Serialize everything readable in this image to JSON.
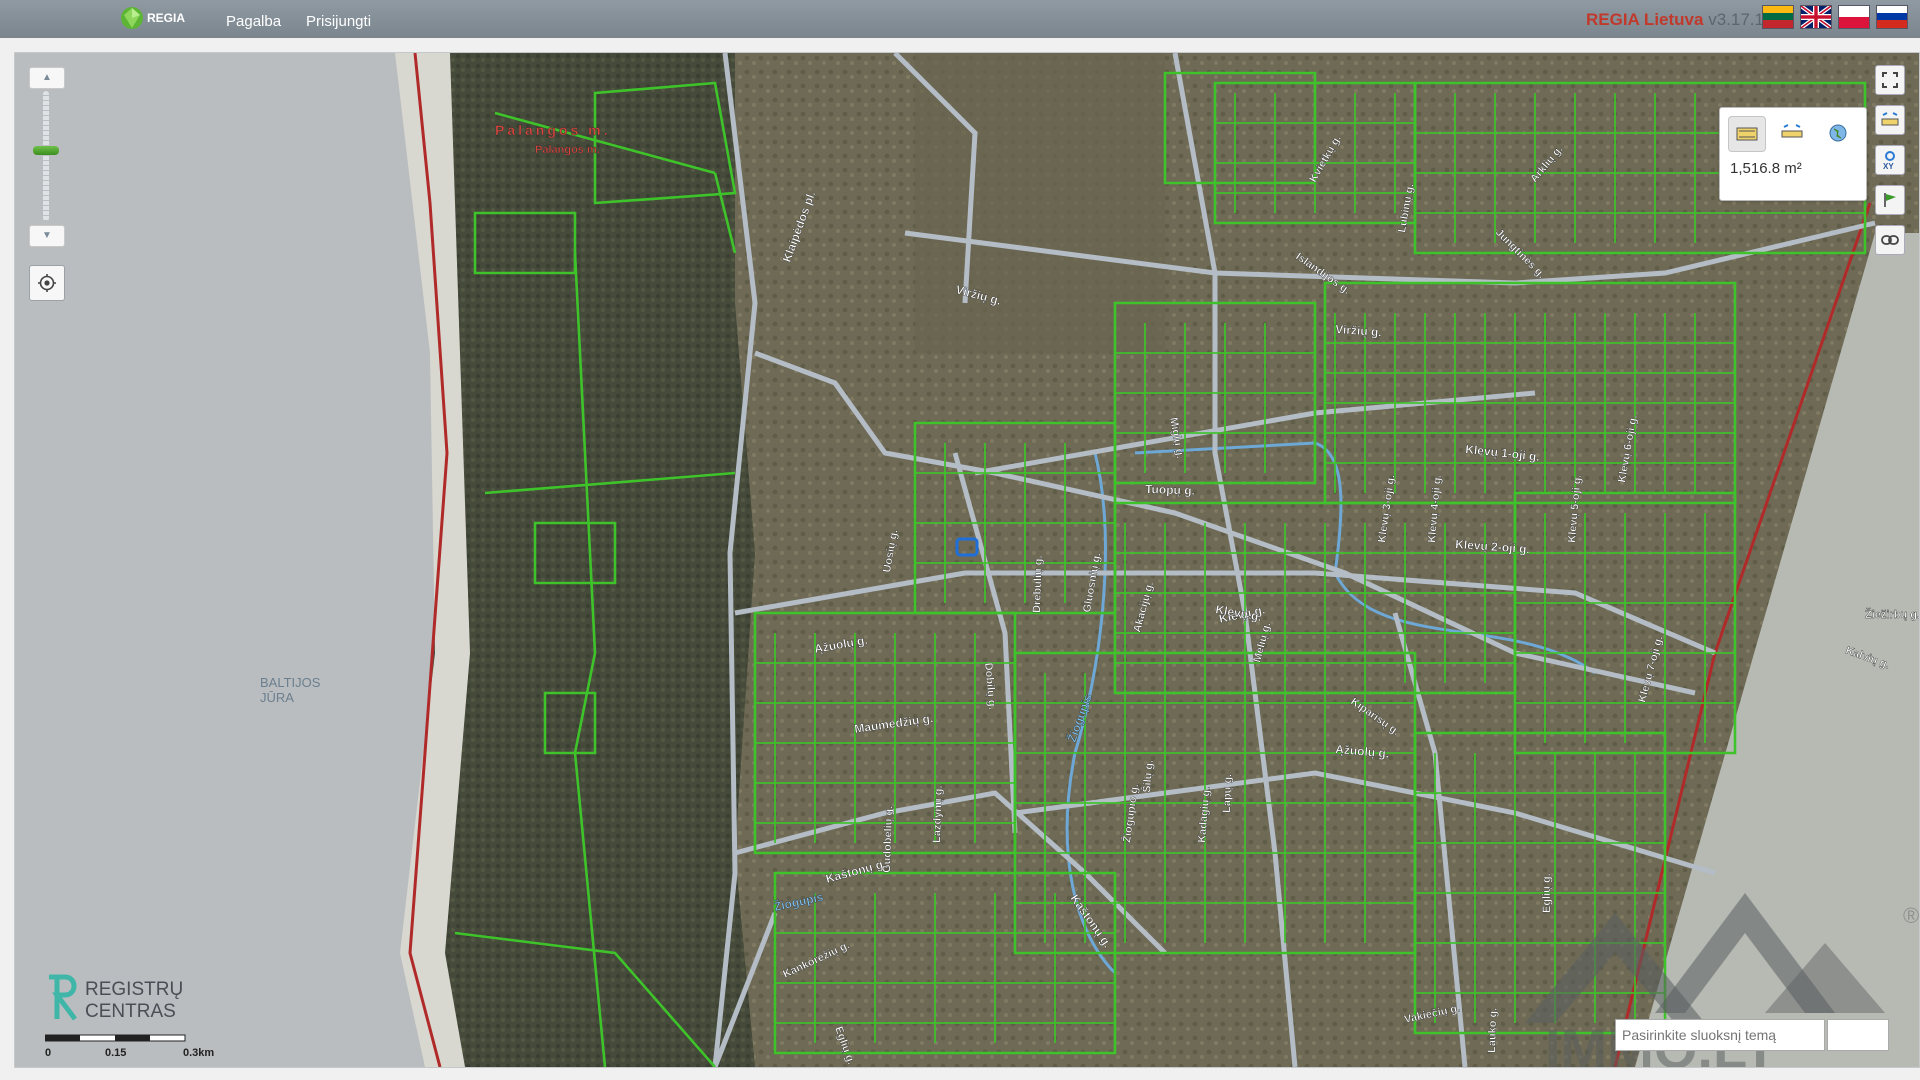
{
  "header": {
    "logo_text": "REGIA",
    "nav": [
      "Pagalba",
      "Prisijungti"
    ],
    "brand": "REGIA Lietuva",
    "version": "v3.17.1",
    "languages": [
      "lt",
      "en",
      "pl",
      "ru"
    ]
  },
  "map": {
    "sea_label_line1": "BALTIJOS",
    "sea_label_line2": "JŪRA",
    "place_labels": [
      "Palangos m.",
      "Palangos m.",
      "Klaipėdos pl.",
      "Viržių g.",
      "Viržių g.",
      "Kvietkų g.",
      "Jungtinės g.",
      "Arklių g.",
      "Islandijos g.",
      "Lubinų g.",
      "Klevų 1-oji g.",
      "Klevų 2-oji g.",
      "Klevų 3-oji g.",
      "Klevų 4-oji g.",
      "Klevų 5-oji g.",
      "Klevų 6-oji g.",
      "Klevų 7-oji g.",
      "Klevų g.",
      "Tuopų g.",
      "Miglų g.",
      "Klevų g.",
      "Ąžuolų g.",
      "Ąžuolų g.",
      "Uosių g.",
      "Dobilų g.",
      "Drebulių g.",
      "Gluosnių g.",
      "Akacijų g.",
      "Melių g.",
      "Kiparisų g.",
      "Maumedžių g.",
      "Žiogupis",
      "Šilų g.",
      "Lazdynų g.",
      "Gudobelių g.",
      "Kaštonų g.",
      "Kaštonų g.",
      "Žiogupis",
      "Žiogupio g.",
      "Kadagių g.",
      "Lapų g.",
      "Eglių g.",
      "Kankorėžių g.",
      "Eglių g.",
      "Vakiečių g.",
      "Lauko g.",
      "Žiežirbų g.",
      "Kalvių g."
    ],
    "parcel_area": "1,516.8 m²",
    "scale_labels": [
      "0",
      "0.15",
      "0.3km"
    ],
    "search_placeholder": "Pasirinkite sluoksnį temą",
    "registry_logo_line1": "REGISTRŲ",
    "registry_logo_line2": "CENTRAS",
    "watermark": "IMMO.LT"
  },
  "tools": {
    "zoom_in_icon": "zoom-in-icon",
    "zoom_out_icon": "zoom-out-icon",
    "zoom_level_fraction": 0.55,
    "right_tools": [
      "fullscreen-icon",
      "measure-icon",
      "xy-coordinates-icon",
      "flag-icon",
      "link-icon"
    ],
    "measure_tools": [
      "area-measure-icon",
      "distance-measure-icon",
      "globe-icon"
    ]
  },
  "colors": {
    "parcel_boundary": "#3ec42a",
    "road": "#b4bcc6",
    "border": "#b12a2a",
    "river": "#6da8d6",
    "highlight": "#1e6fd9"
  }
}
